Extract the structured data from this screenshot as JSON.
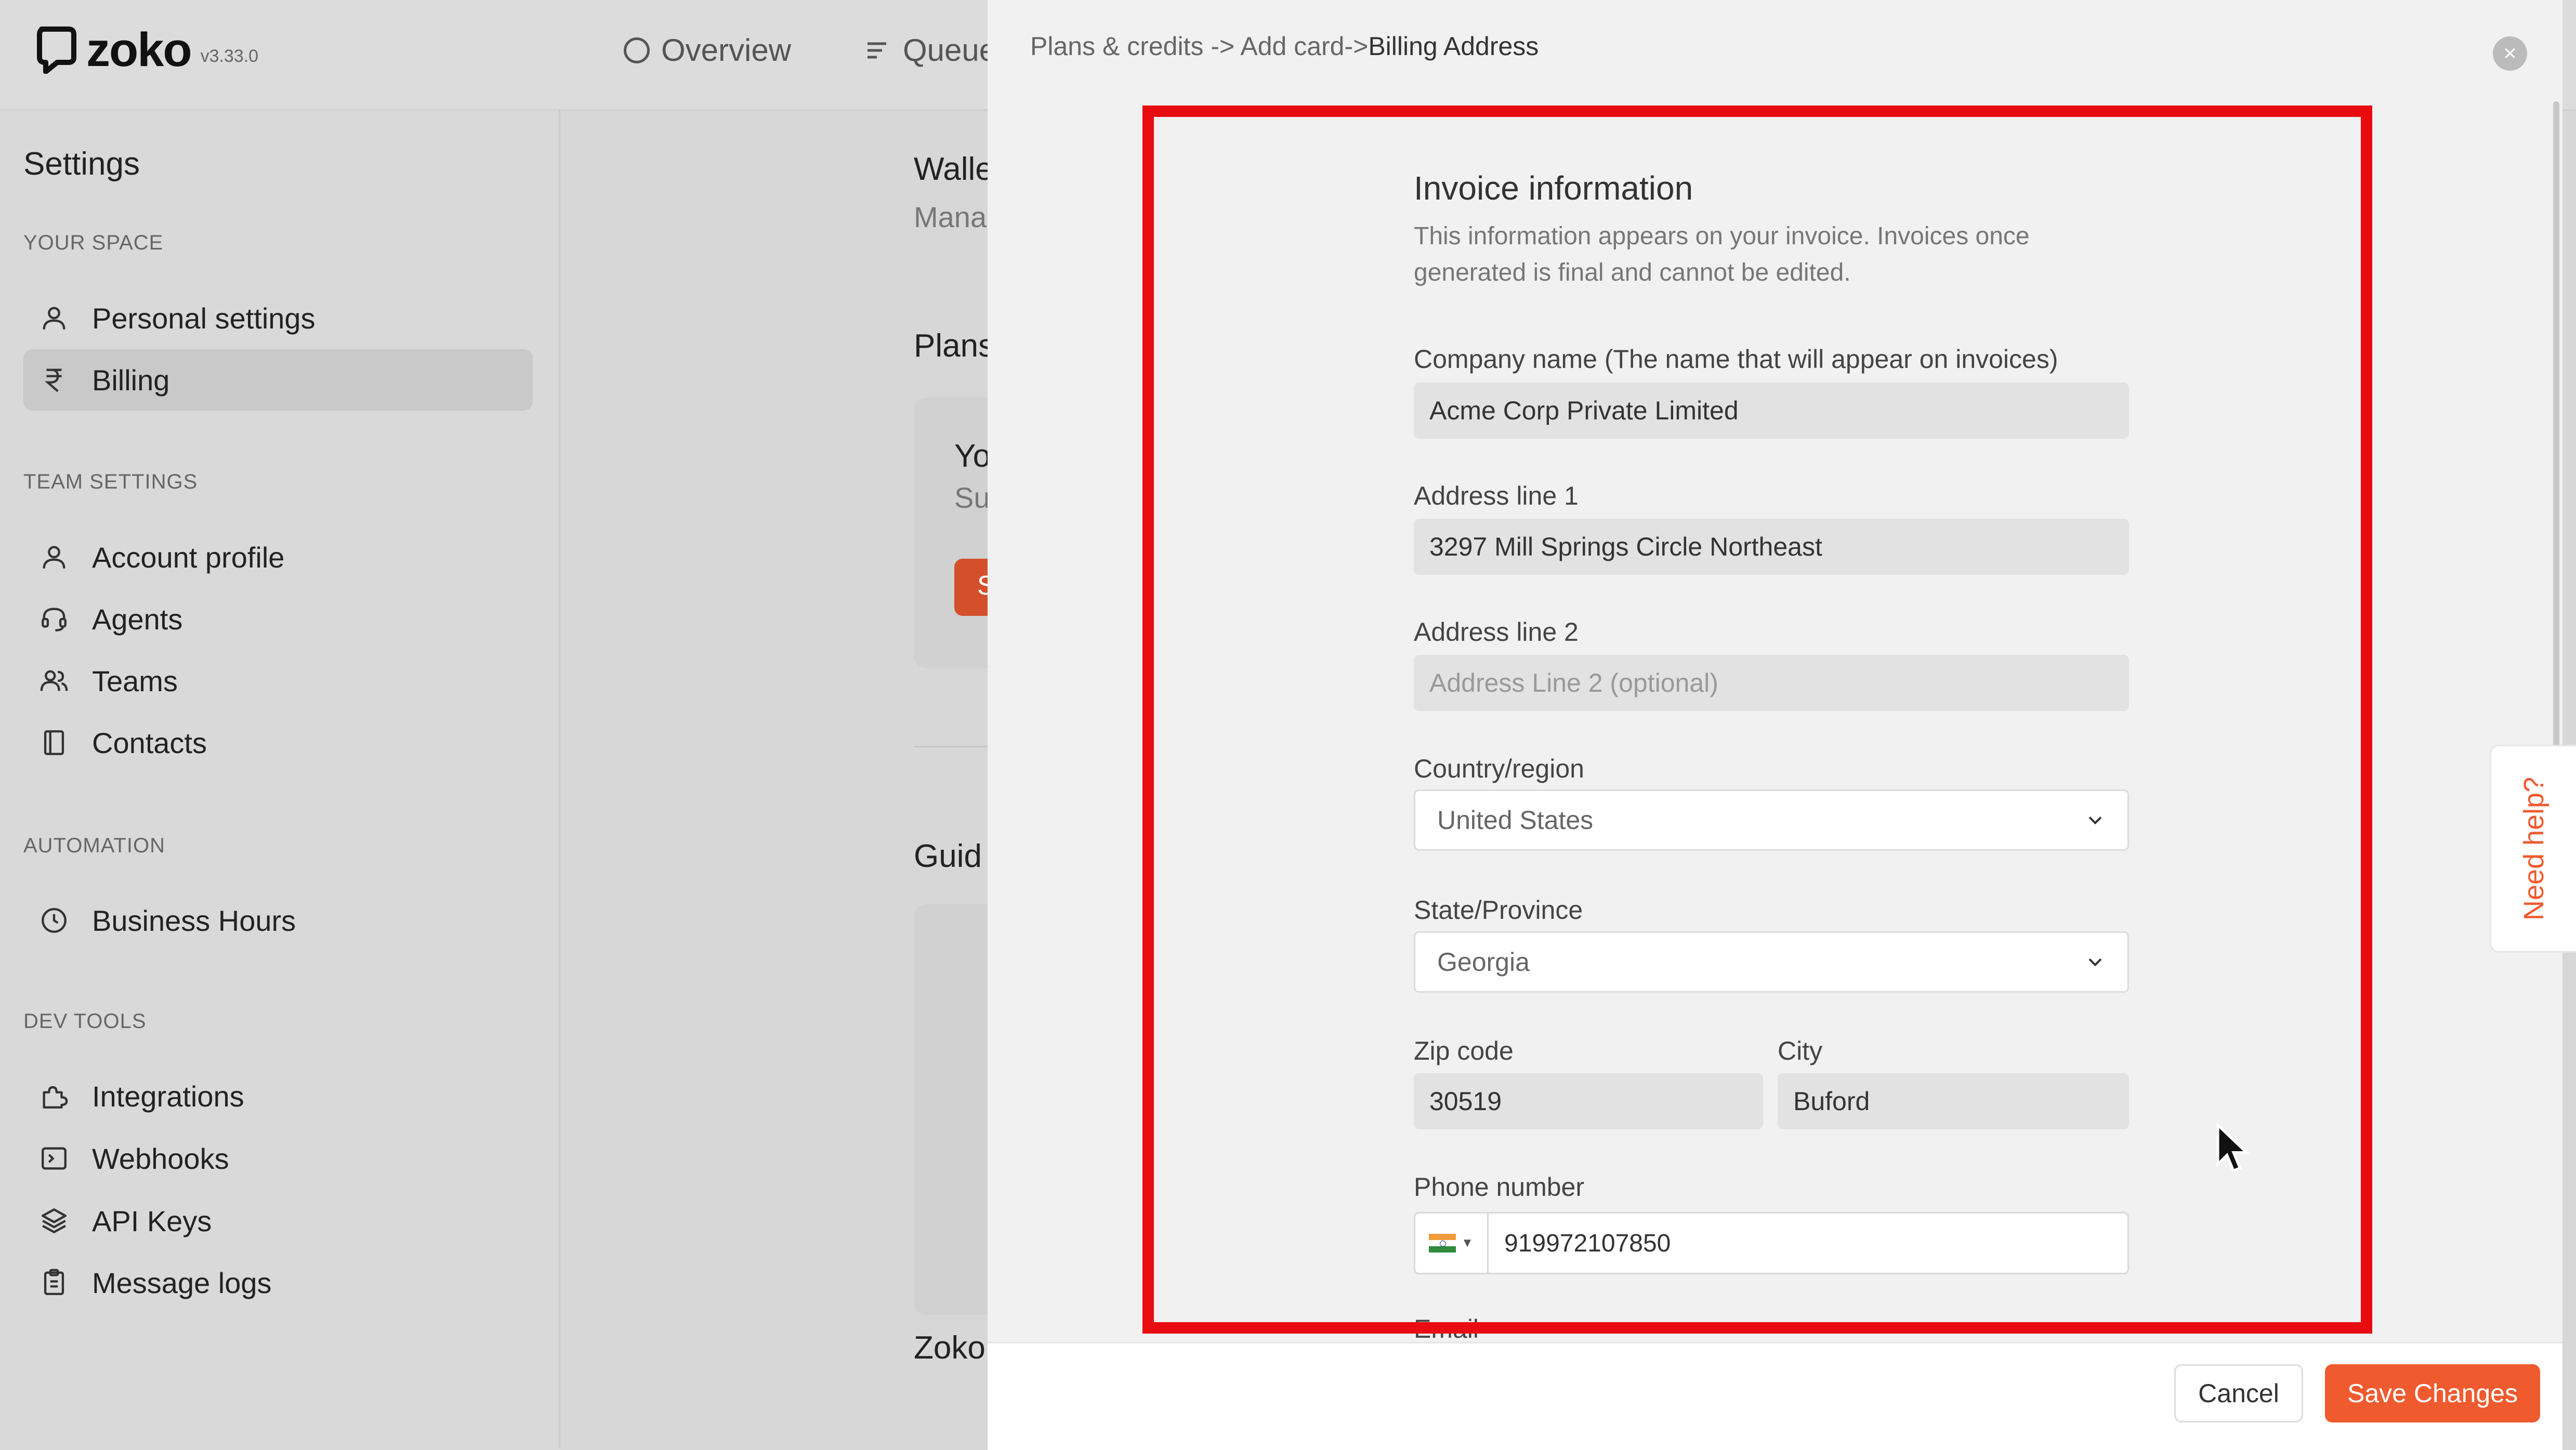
{
  "app": {
    "name": "zoko",
    "version": "v3.33.0"
  },
  "topnav": [
    {
      "label": "Overview"
    },
    {
      "label": "Queue"
    }
  ],
  "sidebar": {
    "title": "Settings",
    "sections": [
      {
        "heading": "YOUR SPACE",
        "items": [
          {
            "label": "Personal settings",
            "icon": "user-icon"
          },
          {
            "label": "Billing",
            "icon": "rupee-icon",
            "active": true
          }
        ]
      },
      {
        "heading": "TEAM SETTINGS",
        "items": [
          {
            "label": "Account profile",
            "icon": "user-icon"
          },
          {
            "label": "Agents",
            "icon": "headset-icon"
          },
          {
            "label": "Teams",
            "icon": "users-icon"
          },
          {
            "label": "Contacts",
            "icon": "contact-book-icon"
          }
        ]
      },
      {
        "heading": "AUTOMATION",
        "items": [
          {
            "label": "Business Hours",
            "icon": "clock-icon"
          }
        ]
      },
      {
        "heading": "DEV TOOLS",
        "items": [
          {
            "label": "Integrations",
            "icon": "puzzle-icon"
          },
          {
            "label": "Webhooks",
            "icon": "terminal-icon"
          },
          {
            "label": "API Keys",
            "icon": "layers-icon"
          },
          {
            "label": "Message logs",
            "icon": "clipboard-icon"
          }
        ]
      }
    ]
  },
  "background": {
    "wallet_title": "Walle",
    "wallet_sub": "Mana",
    "plans": "Plans",
    "card_title": "Yo",
    "card_sub": "Su",
    "card_button": "S",
    "guide": "Guid",
    "zoko": "Zoko"
  },
  "modal": {
    "breadcrumb": {
      "part1": "Plans & credits -> Add card->",
      "part2": "Billing Address"
    },
    "title": "Invoice information",
    "description": "This information appears on your invoice. Invoices once generated is final and cannot be edited.",
    "fields": {
      "company": {
        "label": "Company name (The name that will appear on invoices)",
        "value": "Acme Corp Private Limited"
      },
      "address1": {
        "label": "Address line 1",
        "value": "3297 Mill Springs Circle Northeast"
      },
      "address2": {
        "label": "Address line 2",
        "placeholder": "Address Line 2 (optional)"
      },
      "country": {
        "label": "Country/region",
        "value": "United States"
      },
      "state": {
        "label": "State/Province",
        "value": "Georgia"
      },
      "zip": {
        "label": "Zip code",
        "value": "30519"
      },
      "city": {
        "label": "City",
        "value": "Buford"
      },
      "phone": {
        "label": "Phone number",
        "value": "919972107850",
        "country_flag": "india-flag-icon"
      },
      "email": {
        "label": "Email"
      }
    },
    "cancel_label": "Cancel",
    "save_label": "Save Changes",
    "help_label": "Need help?"
  },
  "colors": {
    "accent": "#ef5a2e",
    "highlight_box": "#e80c10"
  }
}
